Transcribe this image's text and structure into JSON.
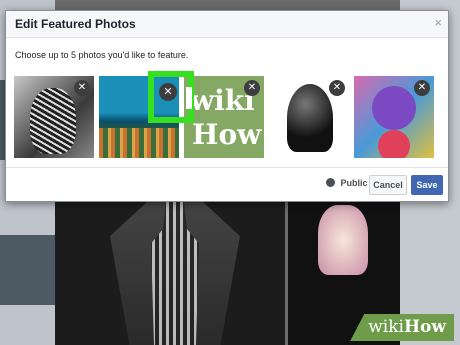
{
  "dialog": {
    "title": "Edit Featured Photos",
    "close": "×",
    "subtitle": "Choose up to 5 photos you'd like to feature.",
    "remove_glyph": "✕"
  },
  "photos": [
    {
      "alt": "Sketched portrait"
    },
    {
      "alt": "Coral reef"
    },
    {
      "alt": "wikiHow logo",
      "text_top": "wiki",
      "text_bottom": "How"
    },
    {
      "alt": "Darth Vader helmet"
    },
    {
      "alt": "Anime doll"
    }
  ],
  "footer": {
    "privacy": "Public",
    "cancel": "Cancel",
    "save": "Save"
  },
  "watermark": {
    "wiki": "wiki",
    "how": "How"
  },
  "colors": {
    "highlight": "#35e01f",
    "primary": "#4267b2"
  }
}
